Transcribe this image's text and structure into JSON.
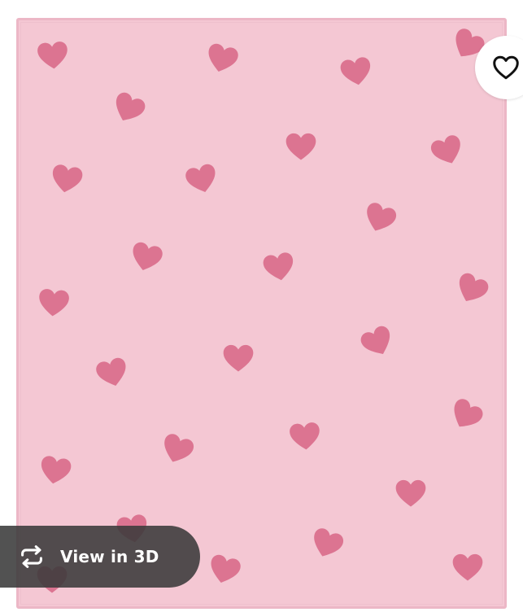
{
  "product_image": {
    "rug_color": "#f4c7d3",
    "heart_color": "#d96a89",
    "pattern": "scattered-hearts"
  },
  "favorite": {
    "icon": "heart-outline-icon"
  },
  "view_3d": {
    "label": "View in 3D",
    "icon": "rotate-3d-icon"
  }
}
